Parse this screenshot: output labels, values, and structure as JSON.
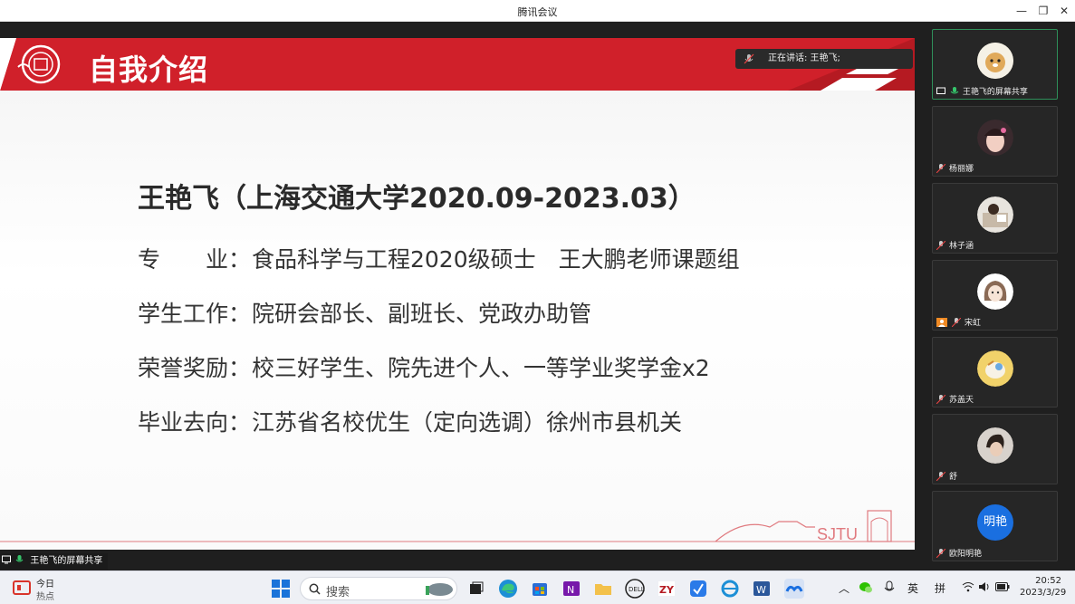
{
  "window": {
    "title": "腾讯会议"
  },
  "slide": {
    "title": "自我介绍",
    "heading": "王艳飞（上海交通大学2020.09-2023.03）",
    "rows": [
      {
        "label": "专　　业：",
        "value": "食品科学与工程2020级硕士　王大鹏老师课题组"
      },
      {
        "label": "学生工作：",
        "value": "院研会部长、副班长、党政办助管"
      },
      {
        "label": "荣誉奖励：",
        "value": "校三好学生、院先进个人、一等学业奖学金x2"
      },
      {
        "label": "毕业去向：",
        "value": "江苏省名校优生（定向选调）徐州市县机关"
      }
    ],
    "footer_logo_text": "SJTU",
    "speaking": "正在讲话: 王艳飞;"
  },
  "share_label": "王艳飞的屏幕共享",
  "participants": [
    {
      "name": "王艳飞的屏幕共享",
      "color": "#e8e0cc"
    },
    {
      "name": "杨丽娜",
      "color": "#4a3a3a"
    },
    {
      "name": "林子涵",
      "color": "#d0c8c0"
    },
    {
      "name": "宋虹",
      "color": "#efe6e6"
    },
    {
      "name": "苏盖天",
      "color": "#f1d26a"
    },
    {
      "name": "舒",
      "color": "#c9c2bc"
    },
    {
      "name": "欧阳明艳",
      "color": "#1a6fe0",
      "initials": "明艳"
    }
  ],
  "taskbar": {
    "weather_top": "今日",
    "weather_bottom": "热点",
    "search_placeholder": "搜索",
    "ime_lang": "英",
    "ime_mode": "拼",
    "time": "20:52",
    "date": "2023/3/29"
  },
  "colors": {
    "accent_red": "#d0202a",
    "active_border": "#2f8f5a",
    "avatar_blue": "#1a6fe0"
  }
}
